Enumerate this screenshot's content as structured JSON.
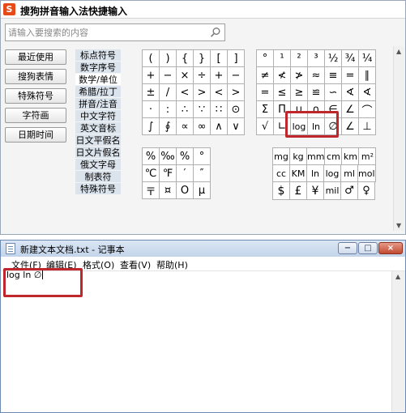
{
  "sogou": {
    "logo": "S",
    "title": "搜狗拼音输入法快捷输入",
    "search_placeholder": "请输入要搜索的内容",
    "side_buttons": [
      "最近使用",
      "搜狗表情",
      "特殊符号",
      "字符画",
      "日期时间"
    ],
    "categories": [
      "标点符号",
      "数字序号",
      "数学/单位",
      "希腊/拉丁",
      "拼音/注音",
      "中文字符",
      "英文音标",
      "日文平假名",
      "日文片假名",
      "俄文字母",
      "制表符",
      "特殊符号"
    ],
    "active_category": 2,
    "math_symbols_a": [
      [
        "(",
        ")",
        "{",
        "}",
        "[",
        "]"
      ],
      [
        "+",
        "−",
        "×",
        "÷",
        "+",
        "−"
      ],
      [
        "±",
        "/",
        "<",
        ">",
        "<",
        ">"
      ],
      [
        "·",
        ":",
        "∴",
        "∵",
        "∷",
        "⊙"
      ],
      [
        "∫",
        "∮",
        "∝",
        "∞",
        "∧",
        "∨"
      ]
    ],
    "math_symbols_b": [
      [
        "°",
        "¹",
        "²",
        "³",
        "½",
        "¾",
        "¼"
      ],
      [
        "≠",
        "≮",
        "≯",
        "≈",
        "≡",
        "=",
        "∥"
      ],
      [
        "=",
        "≤",
        "≥",
        "≌",
        "∽",
        "∢",
        "∢"
      ],
      [
        "Σ",
        "Π",
        "∪",
        "∩",
        "∈",
        "∠",
        "⌒"
      ],
      [
        "√",
        "∟",
        "log",
        "ln",
        "∅",
        "∠",
        "⊥"
      ]
    ],
    "misc_symbols": [
      [
        "%",
        "‰",
        "%",
        "°"
      ],
      [
        "℃",
        "℉",
        "′",
        "″"
      ],
      [
        "〒",
        "¤",
        "Ο",
        "μ"
      ]
    ],
    "unit_symbols_a": [
      "mg",
      "kg",
      "mm",
      "cm",
      "km",
      "m²"
    ],
    "unit_symbols_b": [
      "cc",
      "KM",
      "ln",
      "log",
      "ml",
      "mol"
    ],
    "currency_symbols": [
      "$",
      "£",
      "¥",
      "mil",
      "♂",
      "♀"
    ]
  },
  "notepad": {
    "title": "新建文本文档.txt - 记事本",
    "menu": [
      "文件(F)",
      "编辑(E)",
      "格式(O)",
      "查看(V)",
      "帮助(H)"
    ],
    "content": "log ln ∅",
    "minimize": "−",
    "maximize": "□",
    "close": "×"
  }
}
